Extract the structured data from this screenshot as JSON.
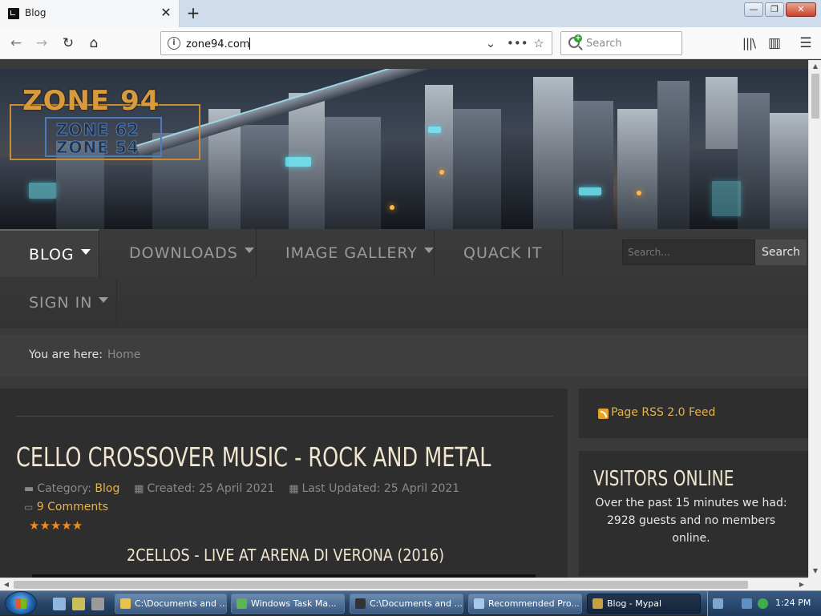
{
  "browser": {
    "tab_title": "Blog",
    "tab_close": "✕",
    "new_tab": "+",
    "url": "zone94.com",
    "search_placeholder": "Search",
    "window_buttons": [
      "—",
      "❐",
      "✕"
    ]
  },
  "site": {
    "logo_main": "ZONE 94",
    "logo_sub1": "ZONE 62",
    "logo_sub2": "ZONE 54",
    "menu": [
      {
        "label": "BLOG",
        "has_dropdown": true,
        "active": true
      },
      {
        "label": "DOWNLOADS",
        "has_dropdown": true,
        "active": false
      },
      {
        "label": "IMAGE GALLERY",
        "has_dropdown": true,
        "active": false
      },
      {
        "label": "QUACK IT",
        "has_dropdown": false,
        "active": false
      },
      {
        "label": "SIGN IN",
        "has_dropdown": true,
        "active": false
      }
    ],
    "search_placeholder": "Search...",
    "search_button": "Search"
  },
  "breadcrumb": {
    "label": "You are here:",
    "home": "Home"
  },
  "article": {
    "title": "CELLO CROSSOVER MUSIC - ROCK AND METAL",
    "category_label": "Category:",
    "category": "Blog",
    "created": "Created: 25 April 2021",
    "updated": "Last Updated: 25 April 2021",
    "comments": "9 Comments",
    "stars": "★★★★★",
    "video_title": "2CELLOS - LIVE AT ARENA DI VERONA (2016)"
  },
  "sidebar": {
    "rss": "Page RSS 2.0 Feed",
    "visitors_title": "VISITORS ONLINE",
    "visitors_text": "Over the past 15 minutes we had: 2928 guests and no members online."
  },
  "taskbar": {
    "buttons": [
      {
        "label": "C:\\Documents and ...",
        "icon_color": "#e8c24a"
      },
      {
        "label": "Windows Task Ma...",
        "icon_color": "#5ab552"
      },
      {
        "label": "C:\\Documents and ...",
        "icon_color": "#333333"
      },
      {
        "label": "Recommended Pro...",
        "icon_color": "#a8c8e8"
      },
      {
        "label": "Blog - Mypal",
        "icon_color": "#c8a040"
      }
    ],
    "clock": "1:24 PM"
  },
  "colors": {
    "accent_gold": "#e6b24a",
    "title_cream": "#f0e6cf",
    "star_orange": "#f08b1d"
  }
}
